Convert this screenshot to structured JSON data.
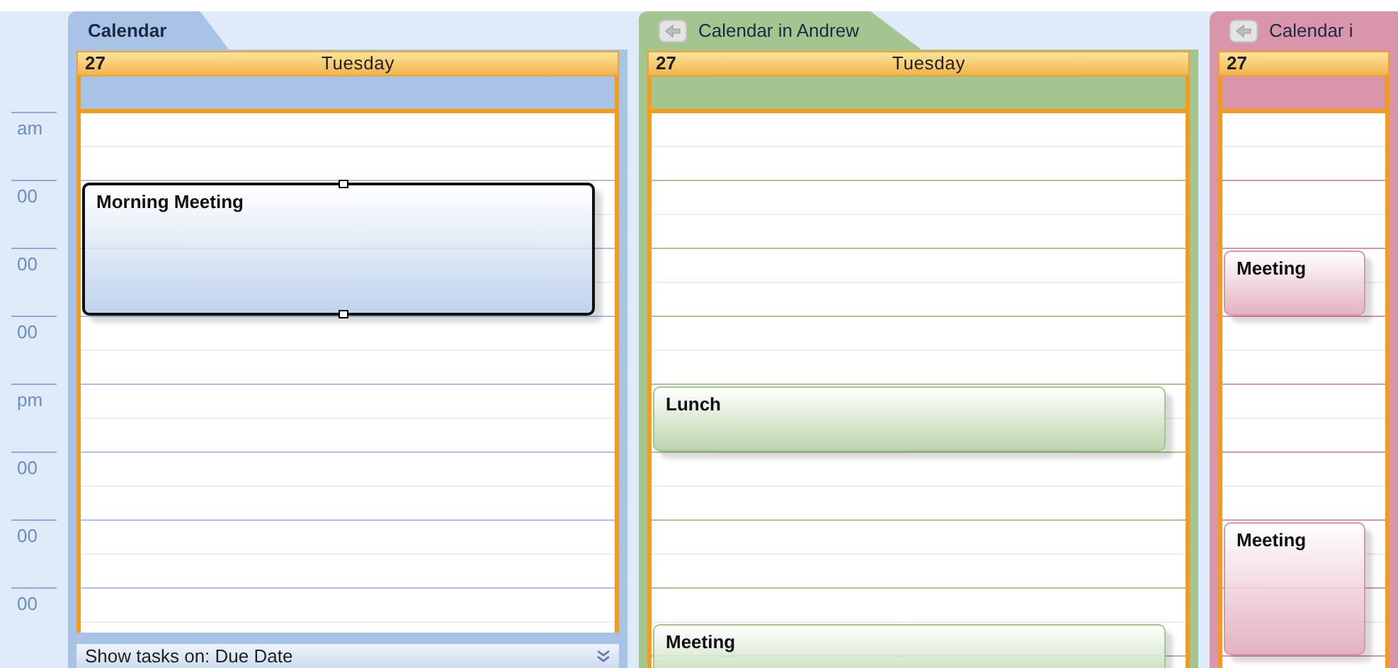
{
  "time_ruler": [
    "am",
    "00",
    "00",
    "00",
    "pm",
    "00",
    "00",
    "00"
  ],
  "calendars": [
    {
      "tab": "Calendar",
      "has_back_button": false,
      "color": "#a9c3e6",
      "day_number": "27",
      "weekday": "Tuesday",
      "events": [
        {
          "title": "Morning Meeting",
          "selected": true
        }
      ],
      "task_bar": "Show tasks on: Due Date"
    },
    {
      "tab": "Calendar in Andrew",
      "has_back_button": true,
      "color": "#a4c590",
      "day_number": "27",
      "weekday": "Tuesday",
      "events": [
        {
          "title": "Lunch",
          "selected": false
        },
        {
          "title": "Meeting",
          "selected": false
        }
      ]
    },
    {
      "tab": "Calendar i",
      "has_back_button": true,
      "color": "#d996ab",
      "day_number": "27",
      "events": [
        {
          "title": "Meeting",
          "selected": false
        },
        {
          "title": "Meeting",
          "selected": false
        }
      ]
    }
  ]
}
